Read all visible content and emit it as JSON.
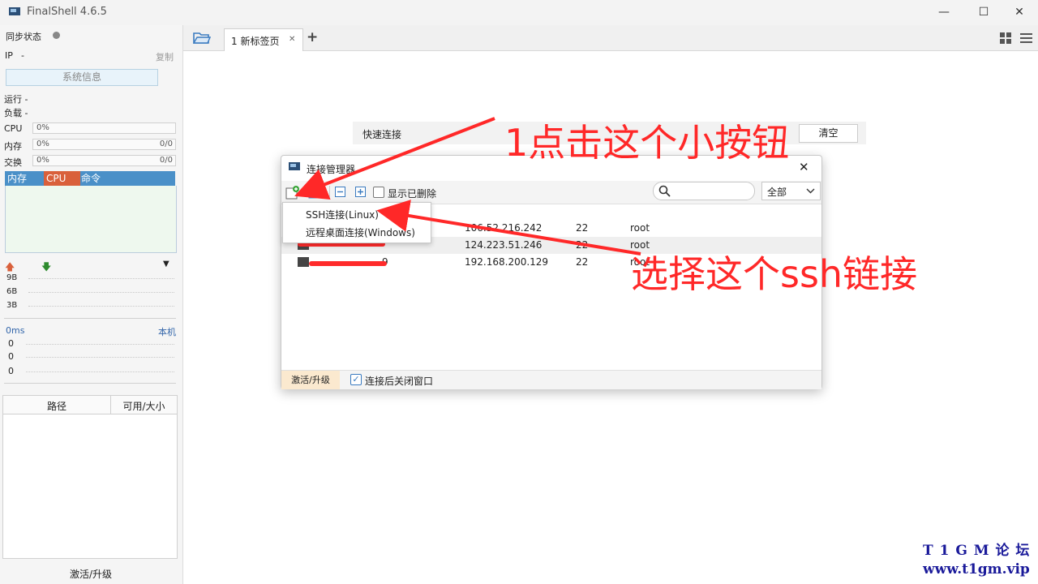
{
  "window": {
    "title": "FinalShell 4.6.5",
    "minimize": "—",
    "maximize": "☐",
    "close": "✕"
  },
  "sidebar": {
    "sync_status": "同步状态",
    "ip_label": "IP",
    "ip_value": "-",
    "copy": "复制",
    "sysinfo_button": "系统信息",
    "run_label": "运行 -",
    "load_label": "负载 -",
    "cpu_label": "CPU",
    "cpu_value": "0%",
    "mem_label": "内存",
    "mem_value": "0%",
    "mem_ratio": "0/0",
    "swap_label": "交换",
    "swap_value": "0%",
    "swap_ratio": "0/0",
    "proc_tabs": [
      "内存",
      "CPU",
      "命令"
    ],
    "net_ticks": [
      "9B",
      "6B",
      "3B"
    ],
    "ping_label": "0ms",
    "ping_local": "本机",
    "ping_ticks": [
      "0",
      "0",
      "0"
    ],
    "disk_headers": [
      "路径",
      "可用/大小"
    ],
    "activate": "激活/升级"
  },
  "tabs": {
    "tab1_label": "1 新标签页",
    "tab_close": "✕",
    "add": "+"
  },
  "quick_connect": {
    "label": "快速连接",
    "clear": "清空"
  },
  "dialog": {
    "title": "连接管理器",
    "show_deleted": "显示已删除",
    "filter": "全部",
    "rows": [
      {
        "ip": "106.52.216.242",
        "port": "22",
        "user": "root"
      },
      {
        "ip": "124.223.51.246",
        "port": "22",
        "user": "root"
      },
      {
        "ip": "192.168.200.129",
        "port": "22",
        "user": "root",
        "name_suffix": "9"
      }
    ],
    "activate": "激活/升级",
    "close_after_connect": "连接后关闭窗口"
  },
  "menu": {
    "items": [
      "SSH连接(Linux)",
      "远程桌面连接(Windows)"
    ]
  },
  "annotations": {
    "step1": "1点击这个小按钮",
    "step2": "选择这个ssh链接"
  },
  "watermark": {
    "line1": "T 1 G M 论 坛",
    "line2": "www.t1gm.vip"
  },
  "colors": {
    "accent": "#4a90c8",
    "annotation": "#ff2828",
    "cpu_tab": "#d9603b"
  }
}
